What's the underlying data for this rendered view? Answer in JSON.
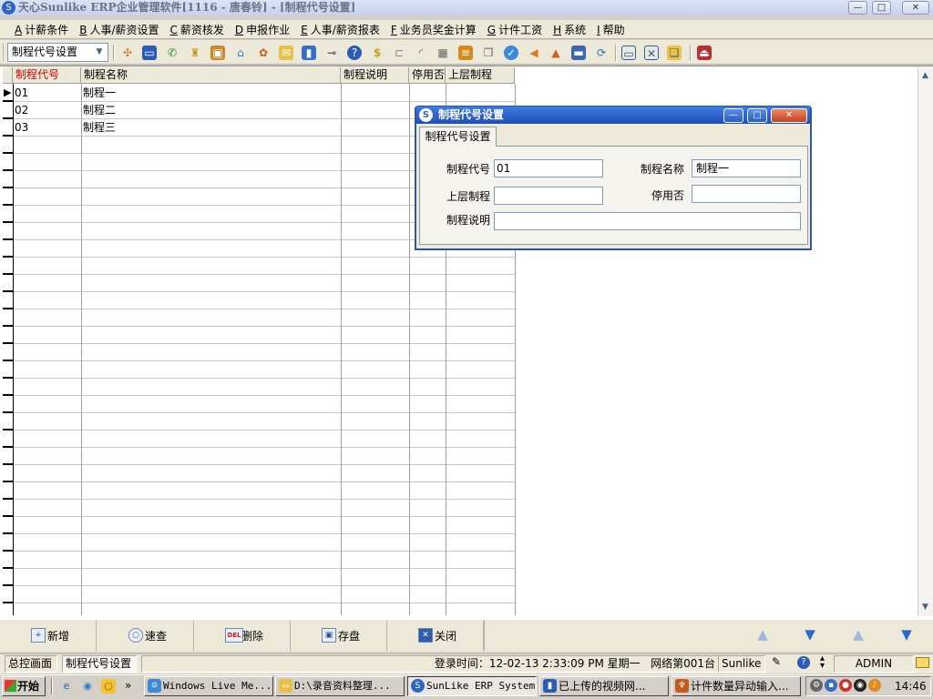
{
  "window": {
    "title": "天心Sunlike ERP企业管理软件[1116 - 唐春铃] - [制程代号设置]"
  },
  "menu": [
    {
      "hotkey": "A",
      "label": "计薪条件"
    },
    {
      "hotkey": "B",
      "label": "人事/薪资设置"
    },
    {
      "hotkey": "C",
      "label": "薪资核发"
    },
    {
      "hotkey": "D",
      "label": "申报作业"
    },
    {
      "hotkey": "E",
      "label": "人事/薪资报表"
    },
    {
      "hotkey": "F",
      "label": "业务员奖金计算"
    },
    {
      "hotkey": "G",
      "label": "计件工资"
    },
    {
      "hotkey": "H",
      "label": "系统"
    },
    {
      "hotkey": "I",
      "label": "帮助"
    }
  ],
  "toolbar": {
    "module_select": "制程代号设置"
  },
  "grid": {
    "columns": [
      "制程代号",
      "制程名称",
      "制程说明",
      "停用否",
      "上层制程"
    ],
    "rows": [
      [
        "01",
        "制程一",
        "",
        "",
        ""
      ],
      [
        "02",
        "制程二",
        "",
        "",
        ""
      ],
      [
        "03",
        "制程三",
        "",
        "",
        ""
      ]
    ]
  },
  "dialog": {
    "title": "制程代号设置",
    "tab": "制程代号设置",
    "fields": {
      "code_label": "制程代号",
      "code_value": "01",
      "name_label": "制程名称",
      "name_value": "制程一",
      "parent_label": "上层制程",
      "parent_value": "",
      "disabled_label": "停用否",
      "disabled_value": "",
      "desc_label": "制程说明",
      "desc_value": ""
    }
  },
  "buttons": {
    "add": "新增",
    "add_icon": "+",
    "quick": "速查",
    "delete": "删除",
    "delete_icon": "DEL",
    "save": "存盘",
    "close": "关闭"
  },
  "status": {
    "tab_main": "总控画面",
    "tab_current": "制程代号设置",
    "login_time": "登录时间：12-02-13 2:33:09 PM  星期一",
    "station": "网络第001台",
    "product": "Sunlike E",
    "user": "ADMIN"
  },
  "taskbar": {
    "start": "开始",
    "tasks": [
      "Windows Live Me...",
      "D:\\录音资料整理...",
      "SunLike ERP System",
      "已上传的视频网...",
      "计件数量异动输入..."
    ],
    "clock": "14:46",
    "chevron": "»"
  }
}
